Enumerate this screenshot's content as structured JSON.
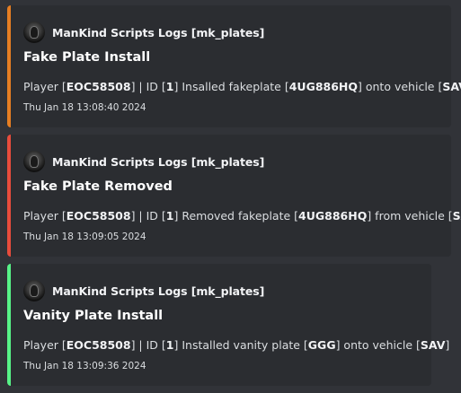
{
  "colors": {
    "embed1": "#e67e22",
    "embed2": "#e74c3c",
    "embed3": "#57f287",
    "background": "#313338",
    "embed_bg": "#2b2d31"
  },
  "embeds": [
    {
      "author": "ManKind Scripts Logs [mk_plates]",
      "avatar_icon": "mask-avatar-icon",
      "title": "Fake Plate Install",
      "desc": {
        "p1": "Player [",
        "b1": "EOC58508",
        "p2": "] | ID [",
        "b2": "1",
        "p3": "] Insalled fakeplate [",
        "b3": "4UG886HQ",
        "p4": "] onto vehicle [",
        "b4": "SAV",
        "p5": "]"
      },
      "timestamp": "Thu Jan 18 13:08:40 2024"
    },
    {
      "author": "ManKind Scripts Logs [mk_plates]",
      "avatar_icon": "mask-avatar-icon",
      "title": "Fake Plate Removed",
      "desc": {
        "p1": "Player [",
        "b1": "EOC58508",
        "p2": "] | ID [",
        "b2": "1",
        "p3": "] Removed fakeplate [",
        "b3": "4UG886HQ",
        "p4": "] from vehicle [",
        "b4": "SAV",
        "p5": "]"
      },
      "timestamp": "Thu Jan 18 13:09:05 2024"
    },
    {
      "author": "ManKind Scripts Logs [mk_plates]",
      "avatar_icon": "mask-avatar-icon",
      "title": "Vanity Plate Install",
      "desc": {
        "p1": "Player [",
        "b1": "EOC58508",
        "p2": "] | ID [",
        "b2": "1",
        "p3": "] Installed vanity plate [",
        "b3": "GGG",
        "p4": "] onto vehicle [",
        "b4": "SAV",
        "p5": "]"
      },
      "timestamp": "Thu Jan 18 13:09:36 2024"
    }
  ]
}
